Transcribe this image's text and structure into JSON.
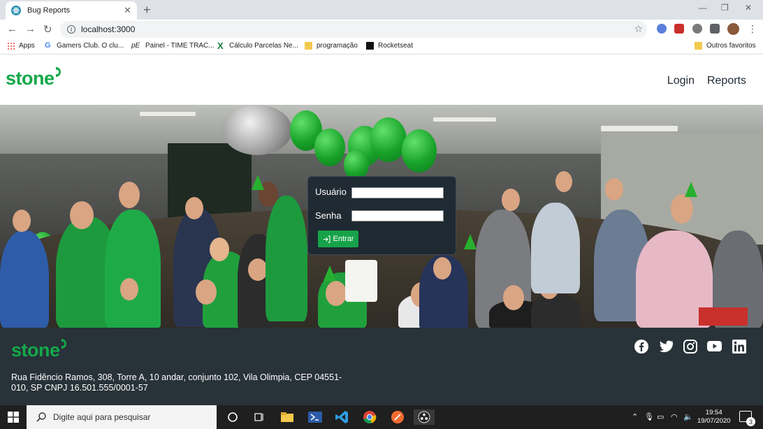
{
  "browser": {
    "tab_title": "Bug Reports",
    "tab_close": "✕",
    "new_tab": "+",
    "url": "localhost:3000",
    "bookmarks": [
      {
        "label": "Apps",
        "icon": "apps-grid-icon"
      },
      {
        "label": "Gamers Club. O clu...",
        "icon": "google-icon"
      },
      {
        "label": "Painel - TIME TRAC...",
        "icon": "pe-icon"
      },
      {
        "label": "Cálculo Parcelas Ne...",
        "icon": "excel-x-icon"
      },
      {
        "label": "programação",
        "icon": "folder-icon"
      },
      {
        "label": "Rocketseat",
        "icon": "rocketseat-icon"
      }
    ],
    "other_bookmarks": "Outros favoritos"
  },
  "header": {
    "logo": "stone",
    "nav": [
      {
        "label": "Login"
      },
      {
        "label": "Reports"
      }
    ]
  },
  "login": {
    "username_label": "Usuário",
    "password_label": "Senha",
    "username_value": "",
    "password_value": "",
    "submit_label": "Entrar"
  },
  "footer": {
    "logo": "stone",
    "address": "Rua Fidêncio Ramos, 308, Torre A, 10 andar, conjunto 102, Vila Olimpia, CEP 04551-010, SP CNPJ 16.501.555/0001-57",
    "social": [
      "facebook-icon",
      "twitter-icon",
      "instagram-icon",
      "youtube-icon",
      "linkedin-icon"
    ]
  },
  "taskbar": {
    "search_placeholder": "Digite aqui para pesquisar",
    "time": "19:54",
    "date": "19/07/2020",
    "notifications": "3"
  },
  "colors": {
    "brand_green": "#14a84a",
    "footer_bg": "#283239",
    "card_bg": "#1c2832"
  }
}
